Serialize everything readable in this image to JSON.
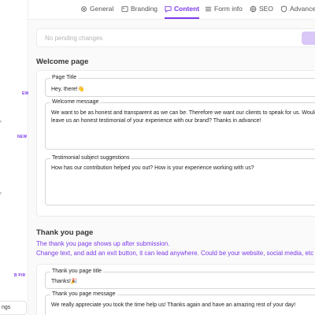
{
  "sidebar": {
    "badges": [
      "EW",
      "NEW",
      "B P/R"
    ],
    "bottom_label": "ngs"
  },
  "tabs": [
    {
      "label": "General",
      "icon": "gear-icon"
    },
    {
      "label": "Branding",
      "icon": "palette-icon"
    },
    {
      "label": "Content",
      "icon": "message-icon"
    },
    {
      "label": "Form info",
      "icon": "list-icon"
    },
    {
      "label": "SEO",
      "icon": "globe-icon"
    },
    {
      "label": "Advanced",
      "icon": "shield-icon"
    }
  ],
  "active_tab": "Content",
  "save_bar": {
    "status": "No pending changes"
  },
  "welcome": {
    "title": "Welcome page",
    "page_title": {
      "label": "Page Title",
      "value": "Hey, there!👋"
    },
    "welcome_message": {
      "label": "Welcome message",
      "value": "We want to be as honest and transparent as we can be. Therefore we want our clients to speak for us. Would y\nleave us an honest testimonial of your experience with our brand? Thanks in advance!"
    },
    "subject_suggestions": {
      "label": "Testimonial subject suggestions",
      "value": "How has our contribution helped you out? How is your experience working with us?"
    }
  },
  "thank_you": {
    "title": "Thank you page",
    "description_line1": "The thank you page shows up after submission.",
    "description_line2": "Change text, and add an exit button, it can lead anywhere. Could be your website, social media, etc",
    "page_title": {
      "label": "Thank you page title",
      "value": "Thanks!🎉"
    },
    "page_message": {
      "label": "Thank you page message",
      "value": "We really appreciate you took the time help us! Thanks again and have an amazing rest of your day!"
    }
  },
  "colors": {
    "accent": "#7c3aed",
    "accent_light": "#d9c7f7"
  }
}
